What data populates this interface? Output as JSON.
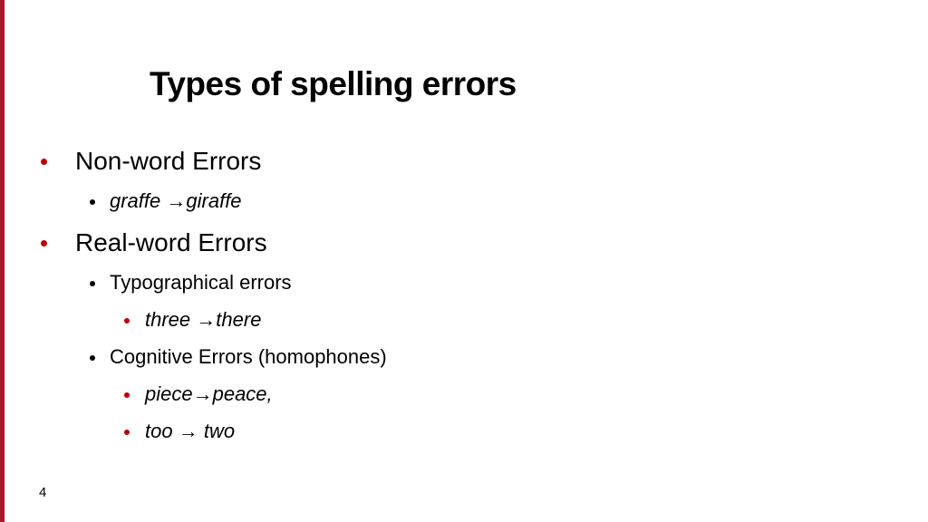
{
  "slide": {
    "title": "Types of spelling errors",
    "page_number": "4",
    "accent_color": "#a6192e",
    "bullets": {
      "nonword": "Non-word Errors",
      "nonword_ex_from": "graffe",
      "nonword_ex_to": "giraffe",
      "realword": "Real-word Errors",
      "typo": "Typographical errors",
      "typo_ex_from": "three",
      "typo_ex_to": "there",
      "cognitive": "Cognitive Errors (homophones)",
      "cog_ex1_from": "piece",
      "cog_ex1_to": "peace,",
      "cog_ex2_from": "too",
      "cog_ex2_to": "two"
    },
    "arrow_glyph": "→",
    "bullet_glyph": "•"
  }
}
